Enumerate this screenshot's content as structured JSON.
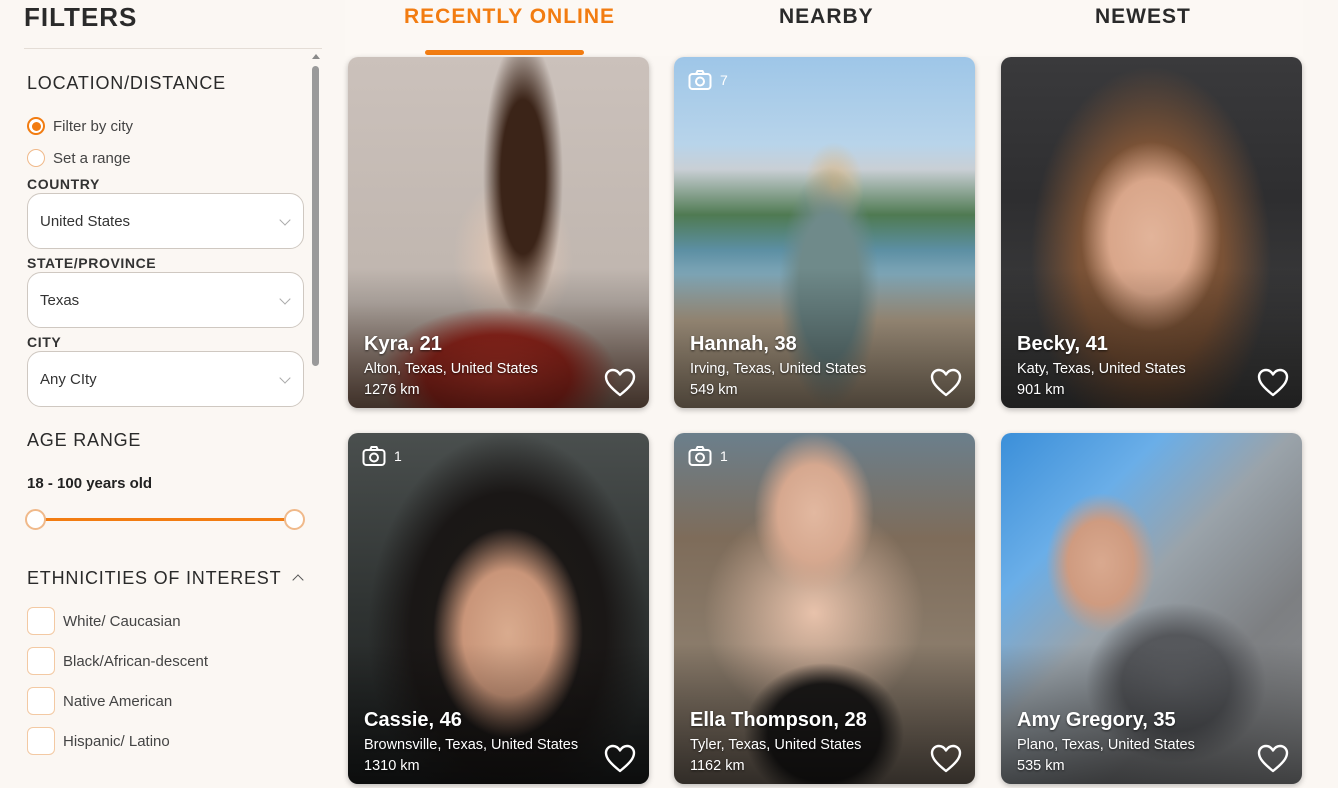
{
  "sidebar": {
    "title": "FILTERS",
    "location": {
      "heading": "LOCATION/DISTANCE",
      "options": [
        {
          "label": "Filter by city",
          "checked": true
        },
        {
          "label": "Set a range",
          "checked": false
        }
      ],
      "country_label": "COUNTRY",
      "country_value": "United States",
      "state_label": "STATE/PROVINCE",
      "state_value": "Texas",
      "city_label": "CITY",
      "city_value": "Any CIty"
    },
    "age": {
      "heading": "AGE RANGE",
      "value": "18 - 100 years old"
    },
    "ethnicities": {
      "heading": "ETHNICITIES OF INTEREST",
      "options": [
        "White/ Caucasian",
        "Black/African-descent",
        "Native American",
        "Hispanic/ Latino"
      ]
    }
  },
  "tabs": [
    {
      "label": "RECENTLY ONLINE",
      "active": true
    },
    {
      "label": "NEARBY",
      "active": false
    },
    {
      "label": "NEWEST",
      "active": false
    }
  ],
  "profiles": [
    {
      "name": "Kyra, 21",
      "location": "Alton, Texas, United States",
      "distance": "1276 km",
      "photos": ""
    },
    {
      "name": "Hannah, 38",
      "location": "Irving, Texas, United States",
      "distance": "549 km",
      "photos": "7"
    },
    {
      "name": "Becky, 41",
      "location": "Katy, Texas, United States",
      "distance": "901 km",
      "photos": ""
    },
    {
      "name": "Cassie, 46",
      "location": "Brownsville, Texas, United States",
      "distance": "1310 km",
      "photos": "1"
    },
    {
      "name": "Ella Thompson, 28",
      "location": "Tyler, Texas, United States",
      "distance": "1162 km",
      "photos": "1"
    },
    {
      "name": "Amy Gregory, 35",
      "location": "Plano, Texas, United States",
      "distance": "535 km",
      "photos": ""
    }
  ],
  "colors": {
    "accent": "#f27c11",
    "background": "#fbf7f3"
  },
  "icons": {
    "photo": "camera-icon",
    "like": "heart-icon",
    "dropdown": "chevron-down-icon",
    "collapse": "chevron-up-icon"
  }
}
